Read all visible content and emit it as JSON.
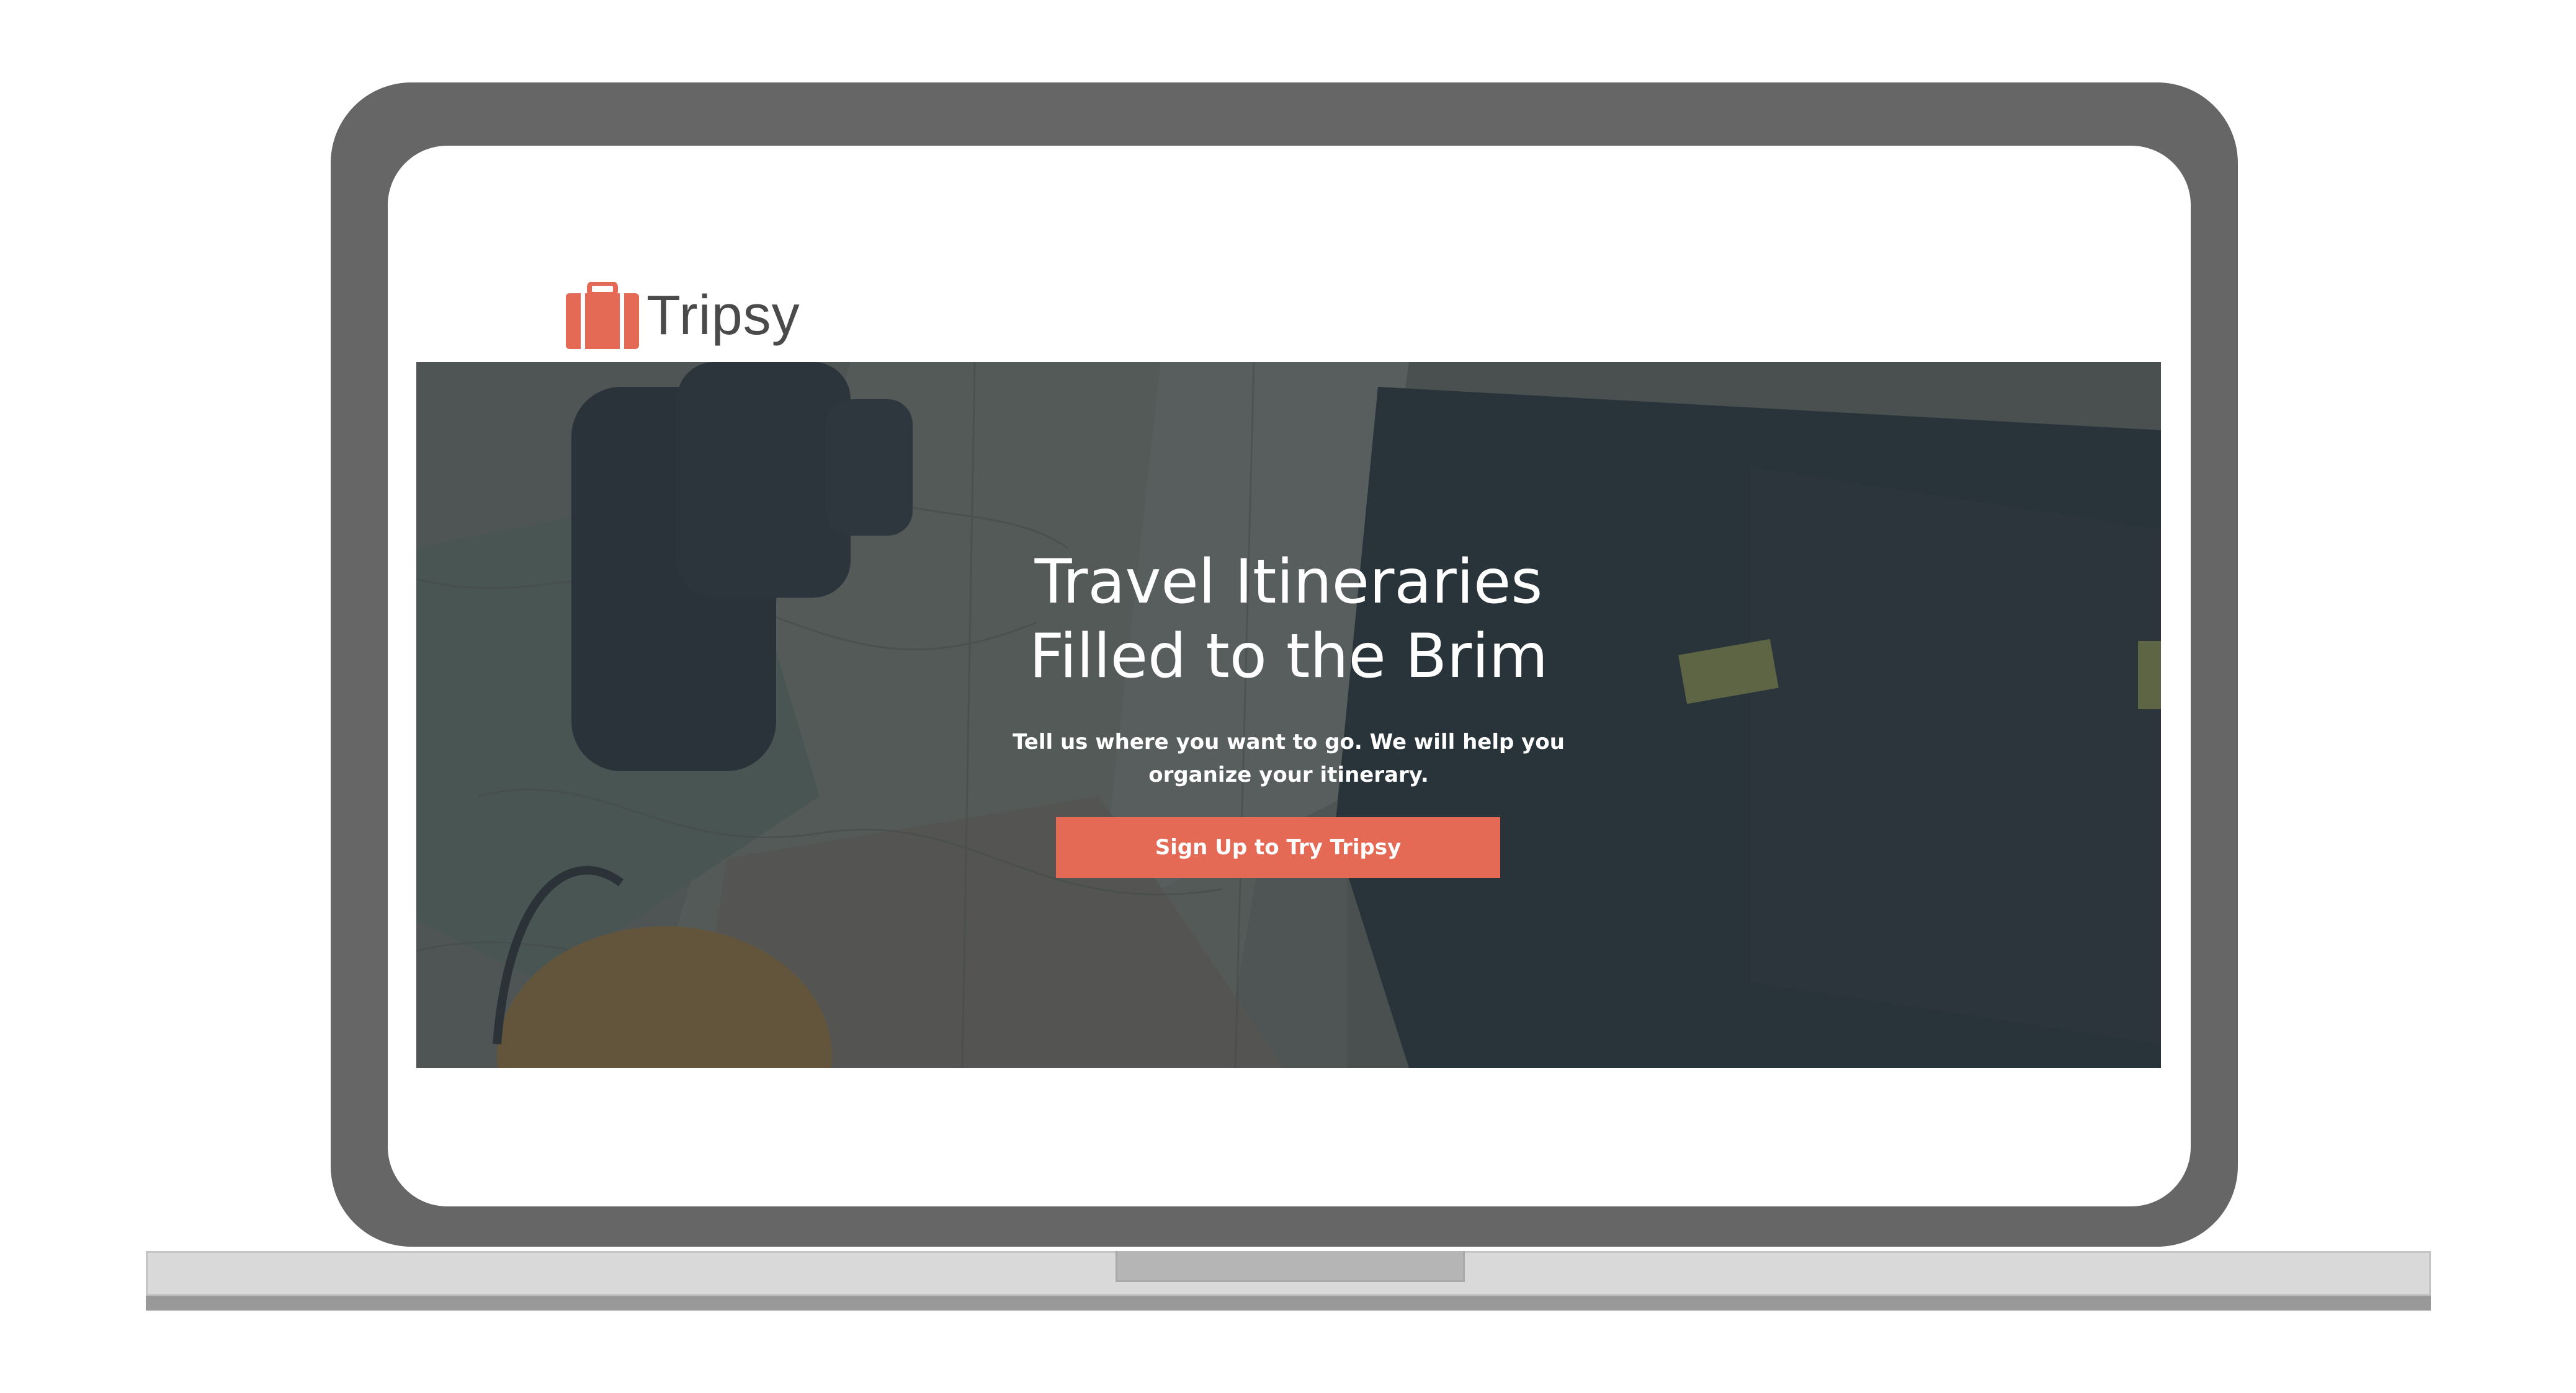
{
  "brand": {
    "name": "Tripsy",
    "logo_icon": "suitcase-icon",
    "accent_color": "#e46a55"
  },
  "hero": {
    "title_line1": "Travel Itineraries",
    "title_line2": "Filled to the Brim",
    "subtitle": "Tell us where you want to go. We will help you organize your itinerary.",
    "cta_label": "Sign Up to Try Tripsy",
    "background_image": "travel-gear-on-map-photo"
  },
  "device": {
    "frame": "laptop-mockup",
    "bezel_color": "#666666"
  }
}
